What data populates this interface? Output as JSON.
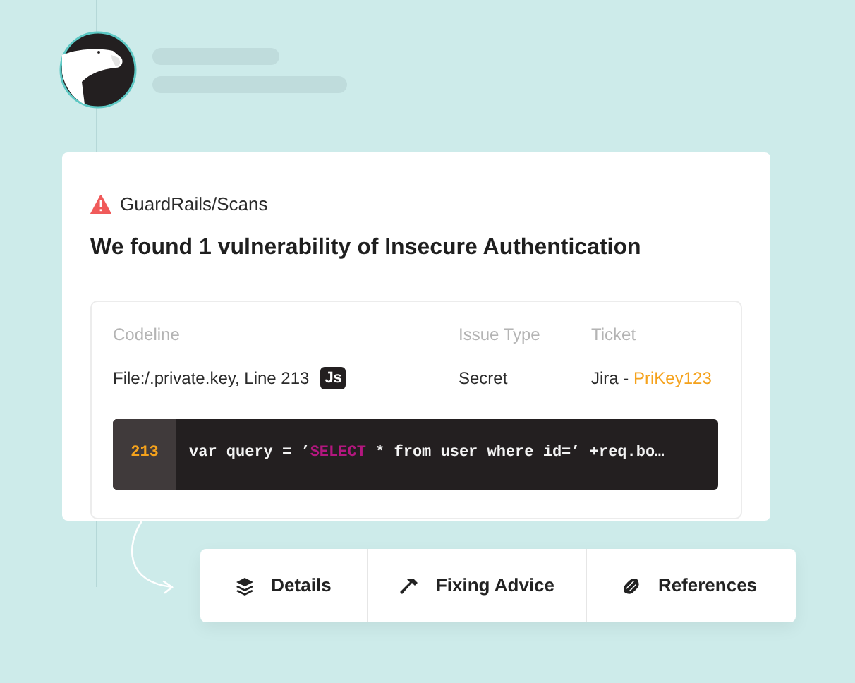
{
  "source": "GuardRails/Scans",
  "title": "We found 1 vulnerability of Insecure Authentication",
  "table": {
    "columns": [
      "Codeline",
      "Issue Type",
      "Ticket"
    ],
    "row": {
      "codeline": "File:/.private.key, Line 213",
      "language_badge": "Js",
      "issue_type": "Secret",
      "ticket_prefix": "Jira - ",
      "ticket_link": "PriKey123"
    }
  },
  "code": {
    "line_number": "213",
    "tokens": [
      {
        "text": "var query = ’",
        "kind": "plain"
      },
      {
        "text": "SELECT",
        "kind": "keyword"
      },
      {
        "text": " * from user where id=’ +req.bo…",
        "kind": "plain"
      }
    ]
  },
  "tabs": [
    {
      "label": "Details",
      "kind": "layers"
    },
    {
      "label": "Fixing Advice",
      "kind": "hammer"
    },
    {
      "label": "References",
      "kind": "link"
    }
  ]
}
